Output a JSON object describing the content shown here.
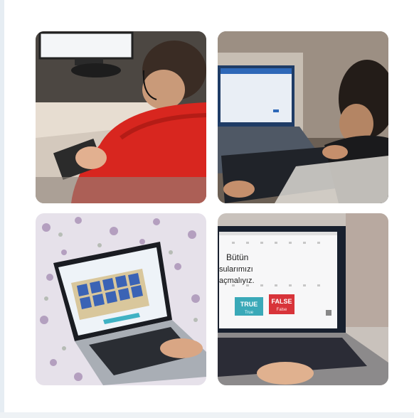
{
  "collage": {
    "photos": [
      {
        "id": "photo-1",
        "subject": "child-at-desktop-keyboard"
      },
      {
        "id": "photo-2",
        "subject": "child-typing-on-laptop"
      },
      {
        "id": "photo-3",
        "subject": "laptop-with-memory-card-game-on-bed"
      },
      {
        "id": "photo-4",
        "subject": "laptop-with-true-false-quiz"
      }
    ]
  },
  "quiz_screen": {
    "line1": "Bütün",
    "line2": "sularımızı",
    "line3": "açmalıyız.",
    "true_label": "TRUE",
    "true_sub": "True",
    "false_label": "FALSE",
    "false_sub": "False"
  },
  "colors": {
    "shirt_red": "#d8261f",
    "true_button": "#3aa9b8",
    "false_button": "#d8343a"
  }
}
